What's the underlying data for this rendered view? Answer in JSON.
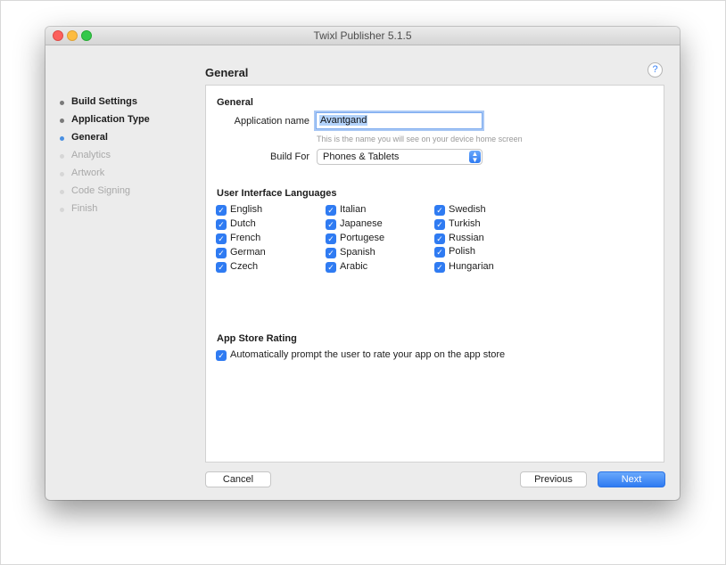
{
  "window": {
    "title": "Twixl Publisher 5.1.5"
  },
  "header": {
    "title": "General",
    "help_label": "?"
  },
  "steps": [
    {
      "label": "Build Settings",
      "state": "done"
    },
    {
      "label": "Application Type",
      "state": "done"
    },
    {
      "label": "General",
      "state": "current"
    },
    {
      "label": "Analytics",
      "state": "todo"
    },
    {
      "label": "Artwork",
      "state": "todo"
    },
    {
      "label": "Code Signing",
      "state": "todo"
    },
    {
      "label": "Finish",
      "state": "todo"
    }
  ],
  "general": {
    "section_title": "General",
    "app_name_label": "Application name",
    "app_name_value": "Avantgand",
    "app_name_hint": "This is the name you will see on your device home screen",
    "build_for_label": "Build For",
    "build_for_value": "Phones & Tablets"
  },
  "languages": {
    "section_title": "User Interface Languages",
    "items": [
      {
        "label": "English",
        "checked": true
      },
      {
        "label": "Dutch",
        "checked": true
      },
      {
        "label": "French",
        "checked": true
      },
      {
        "label": "German",
        "checked": true
      },
      {
        "label": "Czech",
        "checked": true
      },
      {
        "label": "Italian",
        "checked": true
      },
      {
        "label": "Japanese",
        "checked": true
      },
      {
        "label": "Portugese",
        "checked": true
      },
      {
        "label": "Spanish",
        "checked": true
      },
      {
        "label": "Arabic",
        "checked": true
      },
      {
        "label": "Swedish",
        "checked": true
      },
      {
        "label": "Turkish",
        "checked": true
      },
      {
        "label": "Russian",
        "checked": true
      },
      {
        "label": "Polish",
        "checked": true
      },
      {
        "label": "Hungarian",
        "checked": true
      }
    ]
  },
  "rating": {
    "section_title": "App Store Rating",
    "prompt_label": "Automatically prompt the user to rate your app on the app store",
    "prompt_checked": true
  },
  "footer": {
    "cancel_label": "Cancel",
    "previous_label": "Previous",
    "next_label": "Next"
  },
  "colors": {
    "accent": "#2f7bf2",
    "done_dot": "#7a7a7a",
    "todo_text": "#a9a9a9"
  }
}
